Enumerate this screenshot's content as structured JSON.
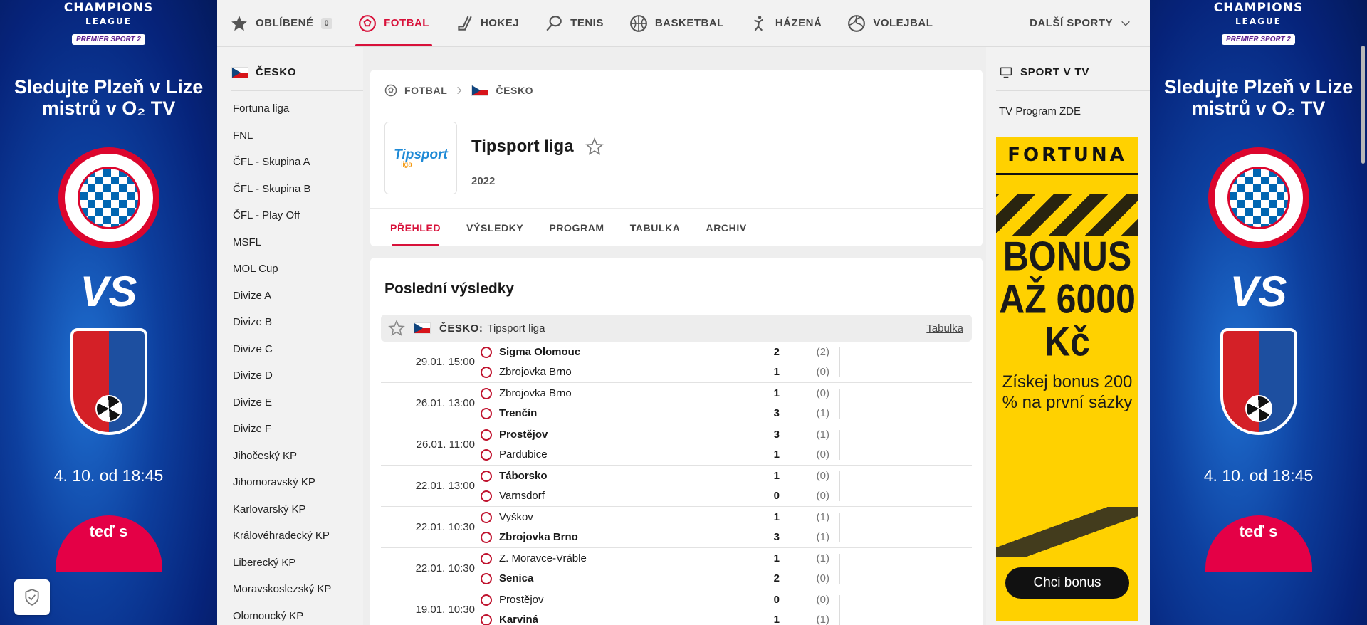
{
  "ads": {
    "left": {
      "league": "CHAMPIONS",
      "league_sub": "LEAGUE",
      "channel": "PREMIER SPORT 2",
      "headline": "Sledujte Plzeň v Lize mistrů v O₂ TV",
      "vs": "VS",
      "date": "4. 10. od 18:45",
      "cta": "teď s"
    },
    "right": {
      "league": "CHAMPIONS",
      "league_sub": "LEAGUE",
      "channel": "PREMIER SPORT 2",
      "headline": "Sledujte Plzeň v Lize mistrů v O₂ TV",
      "vs": "VS",
      "date": "4. 10. od 18:45",
      "cta": "teď s"
    }
  },
  "nav": {
    "favorites_label": "OBLÍBENÉ",
    "favorites_count": "0",
    "items": [
      {
        "label": "FOTBAL",
        "icon": "football-icon"
      },
      {
        "label": "HOKEJ",
        "icon": "hockey-icon"
      },
      {
        "label": "TENIS",
        "icon": "tennis-icon"
      },
      {
        "label": "BASKETBAL",
        "icon": "basketball-icon"
      },
      {
        "label": "HÁZENÁ",
        "icon": "handball-icon"
      },
      {
        "label": "VOLEJBAL",
        "icon": "volleyball-icon"
      }
    ],
    "more_label": "DALŠÍ SPORTY",
    "accent": "#d8113a"
  },
  "left_sidebar": {
    "country": "ČESKO",
    "leagues": [
      "Fortuna liga",
      "FNL",
      "ČFL - Skupina A",
      "ČFL - Skupina B",
      "ČFL - Play Off",
      "MSFL",
      "MOL Cup",
      "Divize A",
      "Divize B",
      "Divize C",
      "Divize D",
      "Divize E",
      "Divize F",
      "Jihočeský KP",
      "Jihomoravský KP",
      "Karlovarský KP",
      "Královéhradecký KP",
      "Liberecký KP",
      "Moravskoslezský KP",
      "Olomoucký KP"
    ]
  },
  "header": {
    "breadcrumb_sport": "FOTBAL",
    "breadcrumb_country": "ČESKO",
    "logo_text": "Tipsport",
    "logo_sub": "liga",
    "league_name": "Tipsport liga",
    "season": "2022",
    "tabs": [
      "PŘEHLED",
      "VÝSLEDKY",
      "PROGRAM",
      "TABULKA",
      "ARCHIV"
    ]
  },
  "results": {
    "title": "Poslední výsledky",
    "group_country": "ČESKO:",
    "group_league": "Tipsport liga",
    "table_link": "Tabulka",
    "matches": [
      {
        "time": "29.01. 15:00",
        "home": "Sigma Olomouc",
        "away": "Zbrojovka Brno",
        "hs": "2",
        "as": "1",
        "hh": "(2)",
        "ah": "(0)",
        "winner": "home"
      },
      {
        "time": "26.01. 13:00",
        "home": "Zbrojovka Brno",
        "away": "Trenčín",
        "hs": "1",
        "as": "3",
        "hh": "(0)",
        "ah": "(1)",
        "winner": "away"
      },
      {
        "time": "26.01. 11:00",
        "home": "Prostějov",
        "away": "Pardubice",
        "hs": "3",
        "as": "1",
        "hh": "(1)",
        "ah": "(0)",
        "winner": "home"
      },
      {
        "time": "22.01. 13:00",
        "home": "Táborsko",
        "away": "Varnsdorf",
        "hs": "1",
        "as": "0",
        "hh": "(0)",
        "ah": "(0)",
        "winner": "home"
      },
      {
        "time": "22.01. 10:30",
        "home": "Vyškov",
        "away": "Zbrojovka Brno",
        "hs": "1",
        "as": "3",
        "hh": "(1)",
        "ah": "(1)",
        "winner": "away"
      },
      {
        "time": "22.01. 10:30",
        "home": "Z. Moravce-Vráble",
        "away": "Senica",
        "hs": "1",
        "as": "2",
        "hh": "(1)",
        "ah": "(0)",
        "winner": "away"
      },
      {
        "time": "19.01. 10:30",
        "home": "Prostějov",
        "away": "Karviná",
        "hs": "0",
        "as": "1",
        "hh": "(0)",
        "ah": "(1)",
        "winner": "away"
      }
    ]
  },
  "right_sidebar": {
    "title": "SPORT V TV",
    "tv_link": "TV Program ZDE",
    "ad": {
      "brand": "FORTUNA",
      "bonus": "BONUS AŽ 6000 Kč",
      "sub": "Získej bonus 200 % na první sázky",
      "cta": "Chci bonus"
    }
  }
}
